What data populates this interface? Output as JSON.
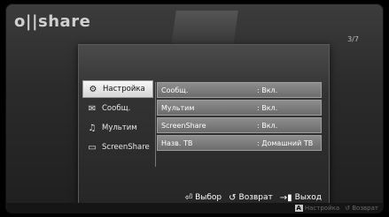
{
  "app": {
    "logo": "o||share"
  },
  "page_counter": "3/7",
  "sidebar": {
    "items": [
      {
        "label": "Настройка",
        "icon": "gear-icon",
        "active": true
      },
      {
        "label": "Сообщ.",
        "icon": "envelope-icon",
        "active": false
      },
      {
        "label": "Мультим",
        "icon": "media-icon",
        "active": false
      },
      {
        "label": "ScreenShare",
        "icon": "screenshare-icon",
        "active": false
      }
    ]
  },
  "settings": [
    {
      "label": "Сообщ.",
      "value": ": Вкл."
    },
    {
      "label": "Мультим",
      "value": ": Вкл."
    },
    {
      "label": "ScreenShare",
      "value": ": Вкл."
    },
    {
      "label": "Назв. ТВ",
      "value": ": Домашний ТВ"
    }
  ],
  "footer": {
    "select": "Выбор",
    "back": "Возврат",
    "exit": "Выход"
  },
  "bottom_bar": {
    "a_key": "A",
    "settings": "Настройка",
    "back": "Возврат"
  }
}
